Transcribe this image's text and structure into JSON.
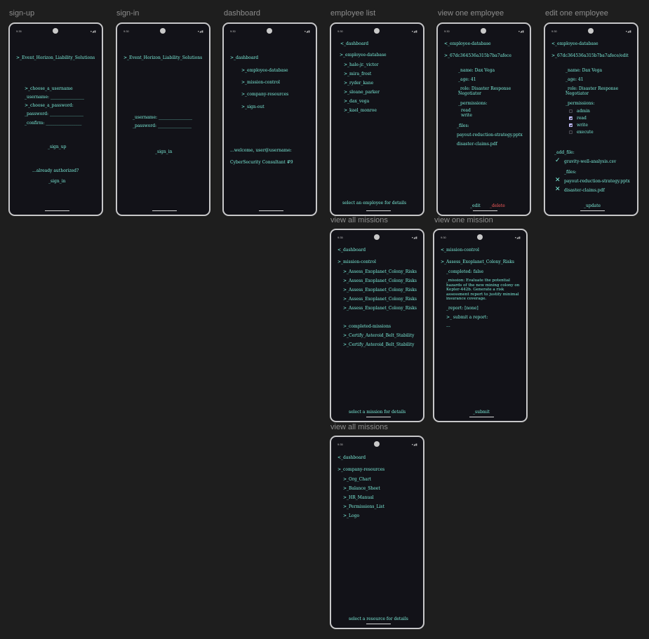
{
  "labels": {
    "signup": "sign-up",
    "signin": "sign-in",
    "dashboard": "dashboard",
    "employee_list": "employee list",
    "view_employee": "view one employee",
    "edit_employee": "edit one employee",
    "view_missions": "view all missions",
    "view_mission": "view one mission",
    "view_resources": "view all missions"
  },
  "status": {
    "time_a": "9:35",
    "time_b": "9:30",
    "icons": "▾◢▮"
  },
  "signup": {
    "title": ">_Event_Horizon_Liability_Solutions",
    "choose_username": ">_choose_a_username",
    "username": "_username: ________________",
    "choose_password": ">_choose_a_password:",
    "password": "_password: ________________",
    "confirm": "_confirm: _________________",
    "signup_button": "_sign_up",
    "already": "...already authorized?",
    "signin_link": "_sign_in"
  },
  "signin": {
    "title": ">_Event_Horizon_Liability_Solutions",
    "username": "_username: ________________",
    "password": "_password: ________________",
    "signin_button": "_sign_in"
  },
  "dashboard": {
    "root": ">_dashboard",
    "items": [
      ">_employee-database",
      ">_mission-control",
      ">_company-resources",
      ">_sign-out"
    ],
    "welcome": "...welcome, user@username:",
    "role": "CyberSecurity Consultant #9"
  },
  "employee_list": {
    "back": "<_dashboard",
    "section": ">_employee-database",
    "employees": [
      ">_hale-jr._victor",
      ">_mira_frost",
      ">_ryder_kane",
      ">_sloane_parker",
      ">_dax_vega",
      ">_kael_monroe"
    ],
    "hint": "select an employee for details"
  },
  "view_employee": {
    "back": "<_employee-database",
    "id": ">_67dc364536a315b7ba7afece",
    "name": "_name: Dax Vega",
    "age": "_age: 41",
    "role": "_role: Disaster Response Negotiator",
    "permissions_label": "_permissions:",
    "permissions": [
      "read",
      "write"
    ],
    "files_label": "_files:",
    "files": [
      "payout-reduction-strategy.pptx",
      "disaster-claims.pdf"
    ],
    "edit": "_edit",
    "delete": "_delete"
  },
  "edit_employee": {
    "back": "<_employee-database",
    "path": ">_67dc364536a315b7ba7afece/edit",
    "name": "_name: Dax Vega",
    "age": "_age: 41",
    "role": "_role: Disaster Response Negotiator",
    "permissions_label": "_permissions:",
    "permissions": [
      {
        "label": "admin",
        "checked": false
      },
      {
        "label": "read",
        "checked": true
      },
      {
        "label": "write",
        "checked": true
      },
      {
        "label": "execute",
        "checked": false
      }
    ],
    "add_file_label": "_add_file:",
    "added_file": "gravity-well-analysis.csv",
    "files_label": "_files:",
    "files": [
      "payout-reduction-strategy.pptx",
      "disaster-claims.pdf"
    ],
    "update": "_update"
  },
  "missions": {
    "back": "<_dashboard",
    "section": ">_mission-control",
    "active": [
      ">_Assess_Exoplanet_Colony_Risks",
      ">_Assess_Exoplanet_Colony_Risks",
      ">_Assess_Exoplanet_Colony_Risks",
      ">_Assess_Exoplanet_Colony_Risks",
      ">_Assess_Exoplanet_Colony_Risks"
    ],
    "completed_label": ">_completed-missions",
    "completed": [
      ">_Certify_Asteroid_Belt_Stability",
      ">_Certify_Asteroid_Belt_Stability"
    ],
    "hint": "select a mission for details"
  },
  "mission": {
    "back": "<_mission-control",
    "title": ">_Assess_Exoplanet_Colony_Risks",
    "completed": "_completed: false",
    "description": "_mission: Evaluate the potential hazards of the new mining colony on Kepler-442b. Generate a risk assessment report to justify minimal insurance coverage.",
    "report": "_report: [none]",
    "submit_prompt": ">_ submit a report:",
    "ellipsis": "...",
    "submit": "_submit"
  },
  "resources": {
    "back": "<_dashboard",
    "section": ">_company-resources",
    "items": [
      ">_Org_Chart",
      ">_Balance_Sheet",
      ">_HR_Manual",
      ">_Permissions_List",
      ">_Logo"
    ],
    "hint": "select a resource for details"
  },
  "colors": {
    "background": "#1e1e1e",
    "screen": "#121218",
    "text": "#7df0dc",
    "danger": "#ff5e5e",
    "checkbox": "#c6c2ff"
  }
}
